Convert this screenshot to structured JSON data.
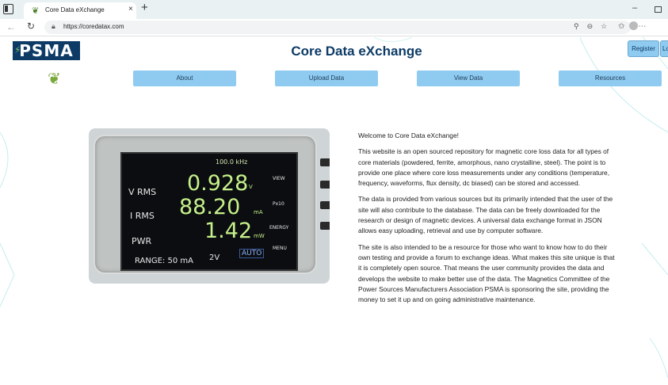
{
  "browser": {
    "tab_title": "Core Data eXchange",
    "tab_close": "×",
    "new_tab": "+",
    "url": "https://coredatax.com",
    "minimize": "–"
  },
  "header": {
    "logo_text": "PSMA",
    "site_title": "Core Data eXchange",
    "register_label": "Register",
    "login_label": "Log"
  },
  "nav": {
    "about": "About",
    "upload": "Upload Data",
    "view": "View Data",
    "resources": "Resources"
  },
  "meter": {
    "freq": "100.0 kHz",
    "v_label": "V RMS",
    "v_value": "0.928",
    "v_unit": "V",
    "i_label": "I RMS",
    "i_value": "88.20",
    "i_unit": "mA",
    "p_label": "PWR",
    "p_value": "1.42",
    "p_unit": "mW",
    "range": "RANGE: 50 mA",
    "range_v": "2V",
    "auto": "AUTO",
    "menu_view": "VIEW",
    "menu_px": "Px10",
    "menu_energy": "ENERGY",
    "menu_menu": "MENU"
  },
  "content": {
    "welcome": "Welcome to Core Data eXchange!",
    "p1": "This website is an open sourced repository for magnetic core loss data for all types of core materials (powdered, ferrite, amorphous, nano crystalline, steel). The point is to provide one place where core loss measurements under any conditions (temperature, frequency, waveforms, flux density, dc biased) can be stored and accessed.",
    "p2": "The data is provided from various sources but its primarily intended that the user of the site will also contribute to the database. The data can be freely downloaded for the research or design of magnetic devices. A universal data exchange format in JSON allows easy uploading, retrieval and use by computer software.",
    "p3": "The site is also intended to be a resource for those who want to know how to do their own testing and provide a forum to exchange ideas. What makes this site unique is that it is completely open source. That means the user community provides the data and develops the website to make better use of the data. The Magnetics Committee of the Power Sources Manufacturers Association PSMA is sponsoring the site, providing the money to set it up and on going administrative maintenance."
  },
  "colors": {
    "nav_button": "#8fcbf0",
    "title_blue": "#0d3b66",
    "lcd_green": "#c6f08a"
  }
}
